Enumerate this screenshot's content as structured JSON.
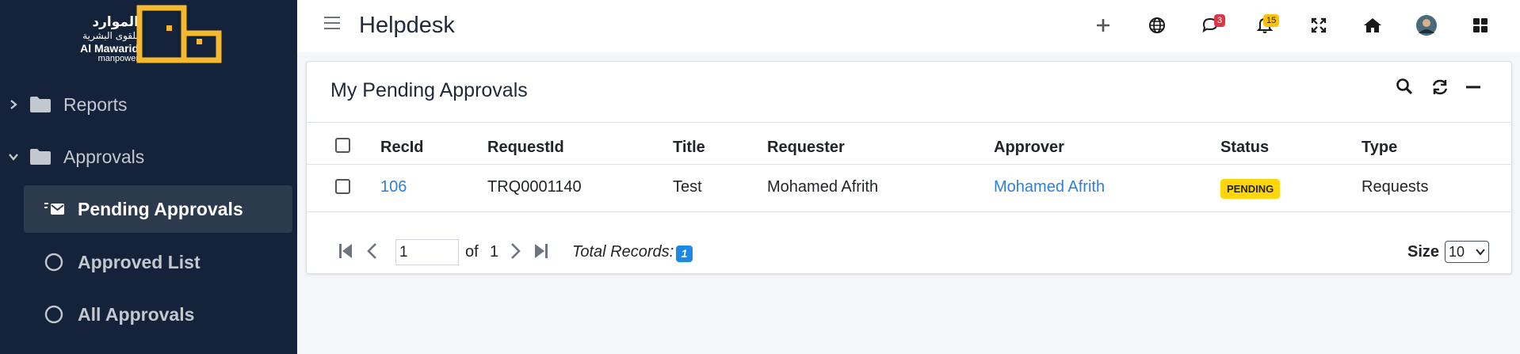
{
  "brand": {
    "arabic_line1": "الموارد",
    "arabic_line2": "للقوى البشرية",
    "english_line1": "Al Mawarid",
    "english_line2": "manpower",
    "accent_color": "#f5b82e"
  },
  "sidebar": {
    "groups": [
      {
        "label": "Reports",
        "icon": "folder-icon",
        "expanded": false
      },
      {
        "label": "Approvals",
        "icon": "folder-icon",
        "expanded": true
      }
    ],
    "items": [
      {
        "label": "Pending Approvals",
        "icon": "mail-list-icon",
        "active": true
      },
      {
        "label": "Approved List",
        "icon": "circle-icon",
        "active": false
      },
      {
        "label": "All Approvals",
        "icon": "circle-icon",
        "active": false
      }
    ]
  },
  "header": {
    "title": "Helpdesk",
    "messages_count": "3",
    "notifications_count": "15"
  },
  "card": {
    "title": "My Pending Approvals",
    "columns": [
      "RecId",
      "RequestId",
      "Title",
      "Requester",
      "Approver",
      "Status",
      "Type"
    ],
    "rows": [
      {
        "recid": "106",
        "requestid": "TRQ0001140",
        "title": "Test",
        "requester": "Mohamed Afrith",
        "approver": "Mohamed Afrith",
        "status": "PENDING",
        "type": "Requests"
      }
    ],
    "pagination": {
      "page": "1",
      "of_label": "of",
      "total_pages": "1",
      "total_records_label": "Total Records:",
      "total_records": "1",
      "size_label": "Size",
      "size_value": "10"
    }
  }
}
